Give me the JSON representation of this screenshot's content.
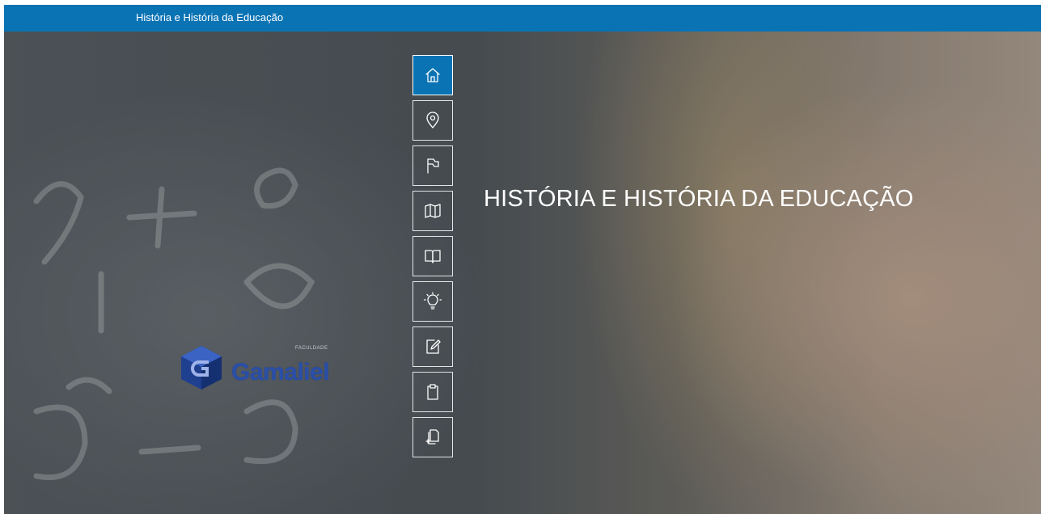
{
  "header": {
    "title": "História e História da Educação",
    "color": "#0a73b4"
  },
  "hero": {
    "headline": "HISTÓRIA E HISTÓRIA DA EDUCAÇÃO"
  },
  "logo": {
    "small_text": "FACULDADE",
    "name": "Gamaliel"
  },
  "nav": {
    "items": [
      {
        "icon": "home-icon",
        "active": true
      },
      {
        "icon": "map-pin-icon",
        "active": false
      },
      {
        "icon": "flag-icon",
        "active": false
      },
      {
        "icon": "map-icon",
        "active": false
      },
      {
        "icon": "book-icon",
        "active": false
      },
      {
        "icon": "lightbulb-icon",
        "active": false
      },
      {
        "icon": "edit-icon",
        "active": false
      },
      {
        "icon": "clipboard-icon",
        "active": false
      },
      {
        "icon": "files-icon",
        "active": false
      }
    ]
  }
}
